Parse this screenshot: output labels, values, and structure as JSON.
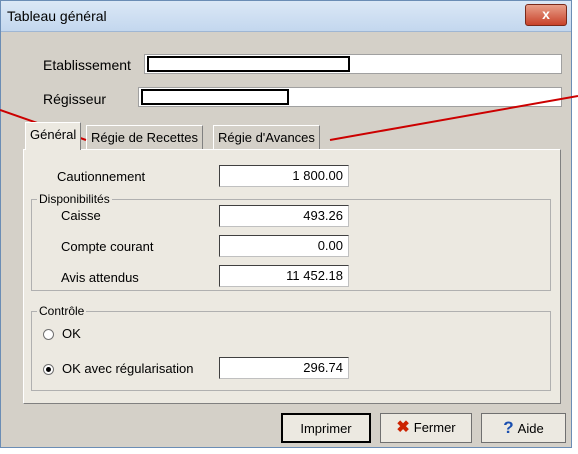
{
  "window": {
    "title": "Tableau général",
    "close_label": "x"
  },
  "header": {
    "etablissement_label": "Etablissement",
    "regisseur_label": "Régisseur"
  },
  "tabs": [
    {
      "label": "Général",
      "active": true
    },
    {
      "label": "Régie de Recettes",
      "active": false
    },
    {
      "label": "Régie d'Avances",
      "active": false
    }
  ],
  "general": {
    "cautionnement_label": "Cautionnement",
    "cautionnement_value": "1 800.00",
    "disponibilites_title": "Disponibilités",
    "caisse_label": "Caisse",
    "caisse_value": "493.26",
    "compte_courant_label": "Compte courant",
    "compte_courant_value": "0.00",
    "avis_attendus_label": "Avis attendus",
    "avis_attendus_value": "11 452.18"
  },
  "controle": {
    "title": "Contrôle",
    "ok_label": "OK",
    "ok_regularisation_label": "OK avec régularisation",
    "regularisation_value": "296.74",
    "selected": "ok_regularisation"
  },
  "buttons": {
    "imprimer": "Imprimer",
    "fermer": "Fermer",
    "aide": "Aide"
  },
  "colors": {
    "annotation_arrow": "#cc0000",
    "fermer_icon": "#cc2200",
    "aide_icon": "#1a4fb0"
  }
}
